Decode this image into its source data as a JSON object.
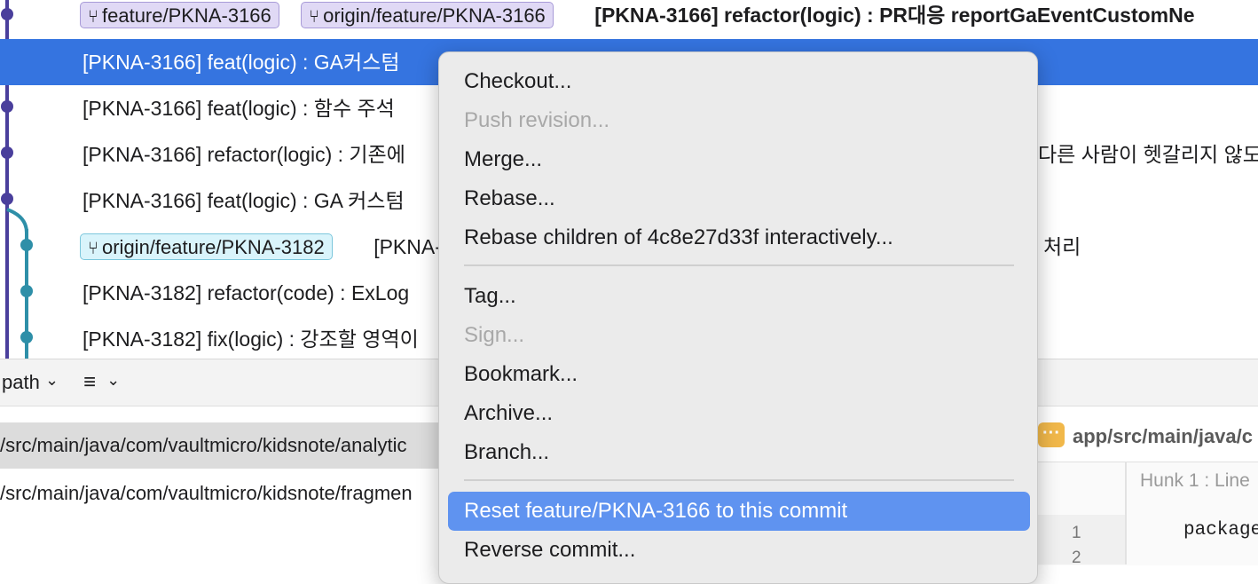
{
  "commits": [
    {
      "tags": [
        {
          "label": "feature/PKNA-3166",
          "style": "purple"
        },
        {
          "label": "origin/feature/PKNA-3166",
          "style": "purple"
        }
      ],
      "message": "[PKNA-3166] refactor(logic) : PR대응 reportGaEventCustomNe",
      "bold": true
    },
    {
      "tags": [],
      "message": "[PKNA-3166] feat(logic) : GA커스텀 ",
      "bold": false,
      "selected": true
    },
    {
      "tags": [],
      "message": "[PKNA-3166] feat(logic) : 함수 주석 ",
      "bold": false
    },
    {
      "tags": [],
      "message": "[PKNA-3166] refactor(logic) : 기존에",
      "tail": "다른 사람이 헷갈리지 않도",
      "bold": false
    },
    {
      "tags": [],
      "message": "[PKNA-3166] feat(logic) : GA 커스텀",
      "bold": false
    },
    {
      "tags": [
        {
          "label": "origin/feature/PKNA-3182",
          "style": "cyan"
        }
      ],
      "message": "[PKNA-",
      "tail": "처리",
      "bold": false
    },
    {
      "tags": [],
      "message": "[PKNA-3182] refactor(code) : ExLog",
      "bold": false
    },
    {
      "tags": [],
      "message": "[PKNA-3182] fix(logic) : 강조할 영역이",
      "bold": false
    }
  ],
  "toolbar": {
    "path_label": "path",
    "path_chevron": "⌄",
    "list_icon": "list-icon",
    "list_chevron": "⌄"
  },
  "files": [
    "/src/main/java/com/vaultmicro/kidsnote/analytic",
    "/src/main/java/com/vaultmicro/kidsnote/fragmen"
  ],
  "diff": {
    "path": "app/src/main/java/c",
    "hunk": "Hunk 1 : Line",
    "line_numbers": [
      "1",
      "2"
    ],
    "code": "package"
  },
  "context_menu": {
    "items": [
      {
        "label": "Checkout...",
        "disabled": false
      },
      {
        "label": "Push revision...",
        "disabled": true
      },
      {
        "label": "Merge...",
        "disabled": false
      },
      {
        "label": "Rebase...",
        "disabled": false
      },
      {
        "label": "Rebase children of 4c8e27d33f interactively...",
        "disabled": false
      },
      {
        "separator": true
      },
      {
        "label": "Tag...",
        "disabled": false
      },
      {
        "label": "Sign...",
        "disabled": true
      },
      {
        "label": "Bookmark...",
        "disabled": false
      },
      {
        "label": "Archive...",
        "disabled": false
      },
      {
        "label": "Branch...",
        "disabled": false
      },
      {
        "separator": true
      },
      {
        "label": "Reset feature/PKNA-3166 to this commit",
        "disabled": false,
        "highlighted": true
      },
      {
        "label": "Reverse commit...",
        "disabled": false
      }
    ]
  },
  "colors": {
    "selection": "#3574e0",
    "graph_main": "#4a3f9c",
    "graph_branch": "#2e8fa8",
    "menu_highlight": "#5f93f0"
  }
}
